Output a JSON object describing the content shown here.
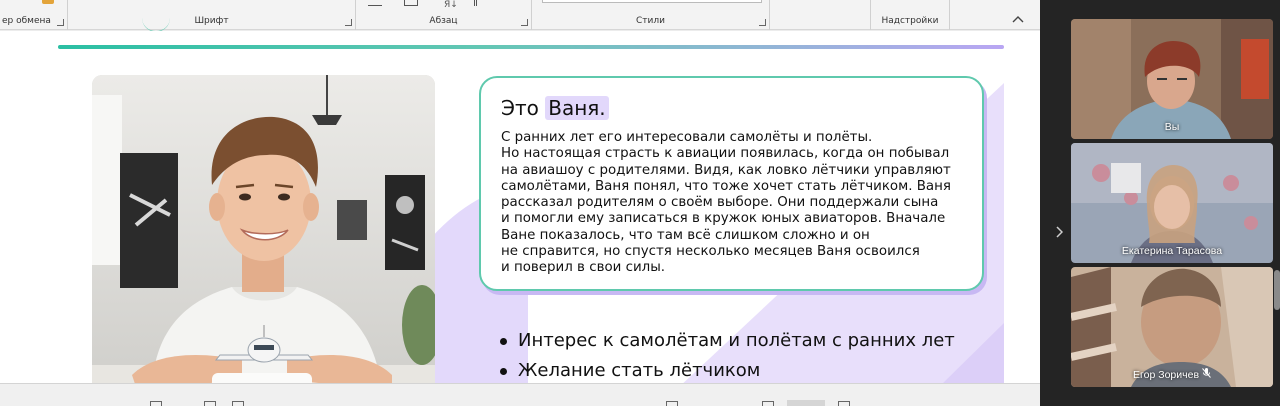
{
  "ribbon": {
    "clipboard_label": "ер обмена",
    "font_label": "Шрифт",
    "paragraph_label": "Абзац",
    "styles_label": "Стили",
    "addins_label": "Надстройки",
    "sort_label": "Я↓"
  },
  "slide": {
    "title_prefix": "Это",
    "title_name": "Ваня.",
    "body": "С ранних лет его интересовали самолёты и полёты.\nНо настоящая страсть к авиации появилась, когда он побывал\nна авиашоу с родителями. Видя, как ловко лётчики управляют\nсамолётами, Ваня понял, что тоже хочет стать лётчиком. Ваня\nрассказал родителям о своём выборе. Они поддержали сына\nи помогли ему записаться в кружок юных авиаторов. Вначале\nВане показалось, что там всё слишком сложно и он\nне справится, но спустя несколько месяцев Ваня освоился\nи поверил в свои силы.",
    "bullets": [
      "Интерес к самолётам и полётам с ранних лет",
      "Желание стать лётчиком"
    ],
    "colors": {
      "accent_green": "#5fc9ad",
      "accent_purple": "#c7b8f3",
      "name_highlight": "#e2d8fb"
    }
  },
  "participants": [
    {
      "name": "Вы"
    },
    {
      "name": "Екатерина Тарасова"
    },
    {
      "name": "Егор Зоричев",
      "status_icon": "mic-muted-icon"
    }
  ],
  "icons": {
    "panel_toggle": "chevron-right-icon",
    "collapse_ribbon": "chevron-up-icon",
    "mic_muted": "mic-muted-icon"
  }
}
